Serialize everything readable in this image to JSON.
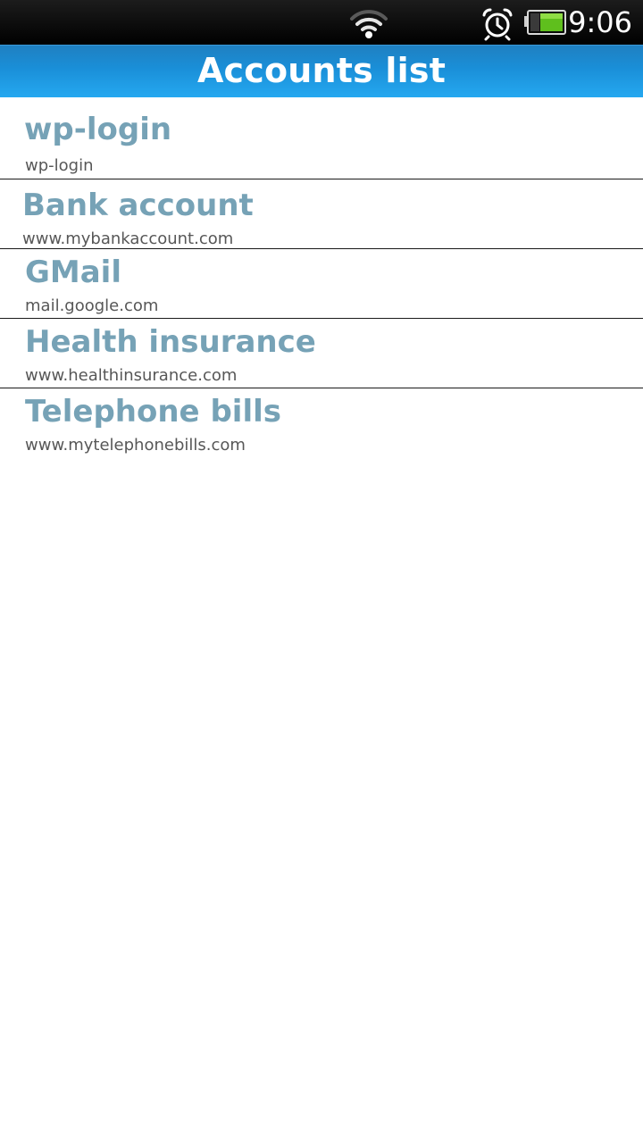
{
  "status_bar": {
    "time": "9:06",
    "icons": [
      "wifi-icon",
      "alarm-clock-icon",
      "battery-icon"
    ]
  },
  "header": {
    "title": "Accounts list"
  },
  "accounts": [
    {
      "name": "wp-login",
      "url": "wp-login"
    },
    {
      "name": "Bank account",
      "url": "www.mybankaccount.com"
    },
    {
      "name": "GMail",
      "url": "mail.google.com"
    },
    {
      "name": "Health insurance",
      "url": "www.healthinsurance.com"
    },
    {
      "name": "Telephone bills",
      "url": "www.mytelephonebills.com"
    }
  ],
  "colors": {
    "title_bar": "#1a8fd8",
    "account_name": "#76a2b6",
    "account_url": "#575757",
    "divider": "#1a1a1a"
  }
}
